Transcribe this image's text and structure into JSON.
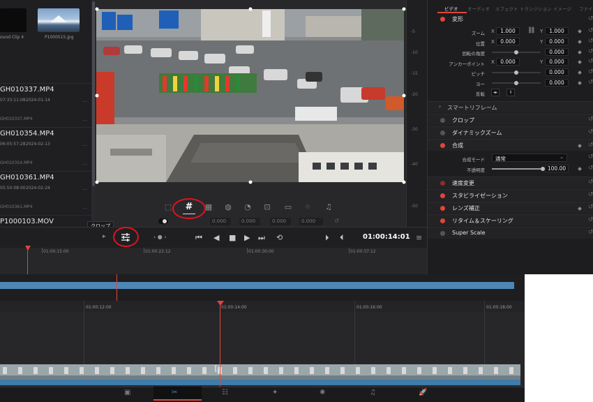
{
  "media_pool": {
    "thumbs": [
      {
        "label": "ound Clip 4"
      },
      {
        "label": "P1000515.jpg"
      }
    ],
    "clips": [
      {
        "name": "GH010337.MP4",
        "duration": "07:33:11:08",
        "date": "2024-01-14",
        "dash": "...",
        "file": "GH010337.MP4"
      },
      {
        "name": "GH010354.MP4",
        "duration": "06:05:57:28",
        "date": "2024-02-13",
        "dash": "...",
        "file": "GH010354.MP4"
      },
      {
        "name": "GH010361.MP4",
        "duration": "05:50:08:00",
        "date": "2024-02-24",
        "dash": "...",
        "file": "GH010361.MP4"
      },
      {
        "name": "P1000103.MOV"
      }
    ]
  },
  "viewer": {
    "crop_tooltip": "クロップ",
    "mini_fields": [
      "0.000",
      "0.000",
      "0.000",
      "0.000"
    ],
    "nav_dots": "‹ ● ›"
  },
  "vruler_ticks": [
    "-5",
    "-10",
    "-15",
    "-20",
    "-30",
    "-40",
    "-50"
  ],
  "inspector": {
    "tabs": [
      "ビデオ",
      "オーディオ",
      "エフェクト",
      "トランジション",
      "イメージ",
      "ファイル"
    ],
    "transform": {
      "title": "変形",
      "zoom_label": "ズーム",
      "zoom_x": "1.000",
      "zoom_y": "1.000",
      "position_label": "位置",
      "position_x": "0.000",
      "position_y": "0.000",
      "rotation_label": "回転の角度",
      "rotation": "0.000",
      "anchor_label": "アンカーポイント",
      "anchor_x": "0.000",
      "anchor_y": "0.000",
      "pitch_label": "ピッチ",
      "pitch": "0.000",
      "yaw_label": "ヨー",
      "yaw": "0.000",
      "flip_label": "反転",
      "x": "X",
      "y": "Y"
    },
    "smart_reframe": "スマートリフレーム",
    "crop": "クロップ",
    "dynamic_zoom": "ダイナミックズーム",
    "composite": {
      "title": "合成",
      "mode_label": "合成モード",
      "mode_value": "通常",
      "opacity_label": "不透明度",
      "opacity_value": "100.00"
    },
    "speed_change": "速度変更",
    "stabilization": "スタビライゼーション",
    "lens_correction": "レンズ補正",
    "retime": "リタイム＆スケーリング",
    "super_scale": "Super Scale"
  },
  "transport": {
    "timecode": "01:00:14:01"
  },
  "upper_timeline": {
    "ticks": [
      "01:00:15:00",
      "01:00:22:12",
      "01:00:30:00",
      "01:00:37:12"
    ]
  },
  "lower_timeline": {
    "ticks": [
      "01:00:12:00",
      "01:00:14:00",
      "01:00:16:00",
      "01:00:18:00"
    ]
  },
  "colors": {
    "accent_red": "#e2453a",
    "track_blue": "#4e86b5",
    "annotation_red": "#e0141e"
  }
}
